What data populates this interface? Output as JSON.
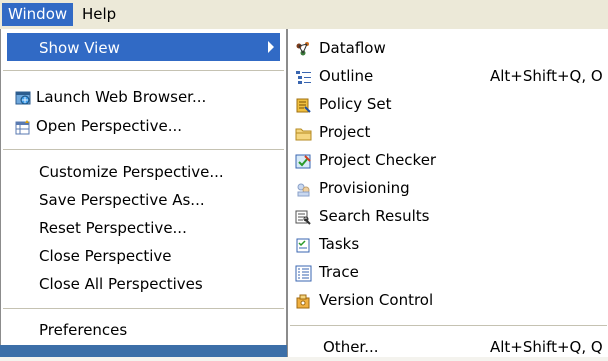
{
  "menubar": {
    "window_label": "Window",
    "help_label": "Help"
  },
  "window_menu": {
    "show_view": "Show View",
    "launch_web_browser": "Launch Web Browser...",
    "open_perspective": "Open Perspective...",
    "customize_perspective": "Customize Perspective...",
    "save_perspective_as": "Save Perspective As...",
    "reset_perspective": "Reset Perspective...",
    "close_perspective": "Close Perspective",
    "close_all_perspectives": "Close All Perspectives",
    "preferences": "Preferences"
  },
  "show_view_menu": {
    "items": [
      {
        "label": "Dataflow",
        "shortcut": "",
        "icon": "dataflow-icon"
      },
      {
        "label": "Outline",
        "shortcut": "Alt+Shift+Q, O",
        "icon": "outline-icon"
      },
      {
        "label": "Policy Set",
        "shortcut": "",
        "icon": "policy-set-icon"
      },
      {
        "label": "Project",
        "shortcut": "",
        "icon": "folder-icon"
      },
      {
        "label": "Project Checker",
        "shortcut": "",
        "icon": "project-checker-icon"
      },
      {
        "label": "Provisioning",
        "shortcut": "",
        "icon": "provisioning-icon"
      },
      {
        "label": "Search Results",
        "shortcut": "",
        "icon": "search-results-icon"
      },
      {
        "label": "Tasks",
        "shortcut": "",
        "icon": "tasks-icon"
      },
      {
        "label": "Trace",
        "shortcut": "",
        "icon": "trace-icon"
      },
      {
        "label": "Version Control",
        "shortcut": "",
        "icon": "version-control-icon"
      }
    ],
    "other_label": "Other...",
    "other_shortcut": "Alt+Shift+Q, Q"
  },
  "colors": {
    "highlight": "#316ac5",
    "menu_bg": "#ffffff",
    "menubar_bg": "#ece9d8"
  }
}
